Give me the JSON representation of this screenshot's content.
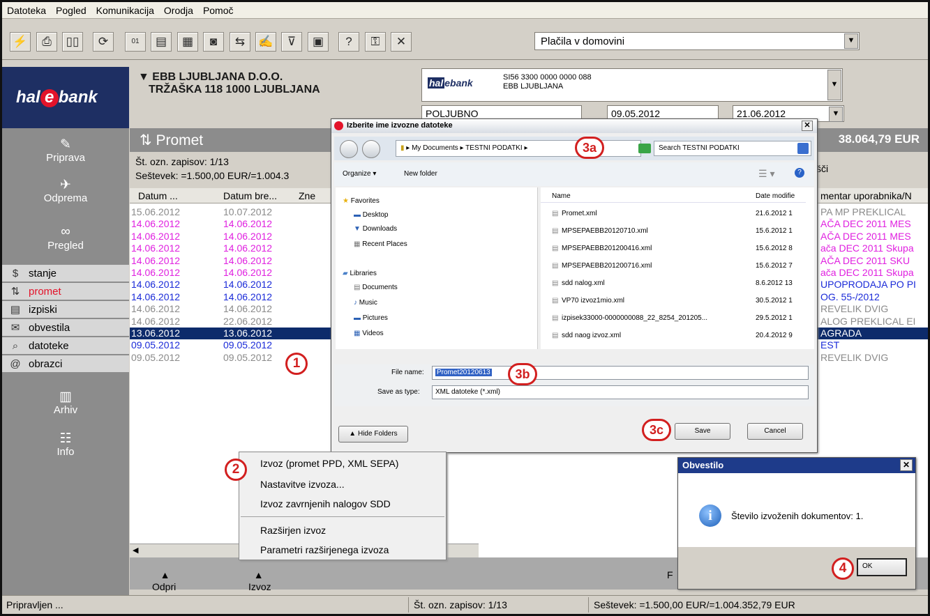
{
  "menu": [
    "Datoteka",
    "Pogled",
    "Komunikacija",
    "Orodja",
    "Pomoč"
  ],
  "toolbar": {
    "icons": [
      "plug-icon",
      "print-icon",
      "book-icon",
      "refresh-icon",
      "binary-icon",
      "document-icon",
      "card-icon",
      "disk-icon",
      "transfer-icon",
      "sign-icon",
      "filter-icon",
      "calculator-icon",
      "help-icon",
      "key-icon",
      "tools-icon"
    ],
    "select_value": "Plačila v domovini"
  },
  "sidebar": {
    "logo": "hal",
    "logo_e": "e",
    "logo_rest": "bank",
    "big_items": [
      {
        "label": "Priprava",
        "icon": "✎"
      },
      {
        "label": "Odprema",
        "icon": "✈"
      },
      {
        "label": "Pregled",
        "icon": "∞"
      }
    ],
    "small_items": [
      {
        "label": "stanje",
        "icon": "$"
      },
      {
        "label": "promet",
        "icon": "⇅"
      },
      {
        "label": "izpiski",
        "icon": "▤"
      },
      {
        "label": "obvestila",
        "icon": "✉"
      },
      {
        "label": "datoteke",
        "icon": "⌕"
      },
      {
        "label": "obrazci",
        "icon": "@"
      }
    ],
    "bottom_items": [
      {
        "label": "Arhiv",
        "icon": "▥"
      },
      {
        "label": "Info",
        "icon": "☷"
      }
    ]
  },
  "header": {
    "company_line1": "EBB LJUBLJANA D.O.O.",
    "company_line2": "TRŽAŠKA 118 1000 LJUBLJANA",
    "account_number": "SI56 3300 0000 0000 088",
    "account_name": "EBB LJUBLJANA",
    "period": "POLJUBNO",
    "date_from": "09.05.2012",
    "date_to": "21.06.2012"
  },
  "promet": {
    "title": "Promet",
    "total": "38.064,79 EUR",
    "record_count": "Št. ozn. zapisov: 1/13",
    "sum": "Seštevek: =1.500,00 EUR/=1.004.3",
    "right_label": "šči"
  },
  "grid": {
    "headers": [
      "Datum ...",
      "Datum bre...",
      "Zne",
      "mentar uporabnika/N"
    ],
    "colors": {
      "gray": "#8a8a8a",
      "magenta": "#e020e0",
      "blue": "#1a2ad8",
      "selected_bg": "#0d2b6b"
    },
    "rows": [
      {
        "d1": "15.06.2012",
        "d2": "10.07.2012",
        "c": "PA MP PREKLICAL",
        "color": "gray"
      },
      {
        "d1": "14.06.2012",
        "d2": "14.06.2012",
        "c": "AČA DEC 2011 MES",
        "color": "magenta"
      },
      {
        "d1": "14.06.2012",
        "d2": "14.06.2012",
        "c": "AČA DEC 2011 MES",
        "color": "magenta"
      },
      {
        "d1": "14.06.2012",
        "d2": "14.06.2012",
        "c": "ača DEC 2011 Skupa",
        "color": "magenta"
      },
      {
        "d1": "14.06.2012",
        "d2": "14.06.2012",
        "c": "AČA DEC 2011 SKU",
        "color": "magenta"
      },
      {
        "d1": "14.06.2012",
        "d2": "14.06.2012",
        "c": "ača DEC 2011 Skupa",
        "color": "magenta"
      },
      {
        "d1": "14.06.2012",
        "d2": "14.06.2012",
        "c": "UPOPRODAJA PO PI",
        "color": "blue"
      },
      {
        "d1": "14.06.2012",
        "d2": "14.06.2012",
        "c": "OG. 55-/2012",
        "color": "blue"
      },
      {
        "d1": "14.06.2012",
        "d2": "14.06.2012",
        "c": "REVELIK DVIG",
        "color": "gray"
      },
      {
        "d1": "14.06.2012",
        "d2": "22.06.2012",
        "c": "ALOG PREKLICAL EI",
        "color": "gray"
      },
      {
        "d1": "13.06.2012",
        "d2": "13.06.2012",
        "c": "AGRADA",
        "color": "selected"
      },
      {
        "d1": "09.05.2012",
        "d2": "09.05.2012",
        "c": "EST",
        "color": "blue"
      },
      {
        "d1": "09.05.2012",
        "d2": "09.05.2012",
        "c": "REVELIK DVIG",
        "color": "gray"
      }
    ]
  },
  "bottom": {
    "odpri": "Odpri",
    "izvoz": "Izvoz",
    "f": "F"
  },
  "status": {
    "ready": "Pripravljen ...",
    "count": "Št. ozn. zapisov: 1/13",
    "sum": "Seštevek: =1.500,00 EUR/=1.004.352,79 EUR"
  },
  "dialog": {
    "title": "Izberite ime izvozne datoteke",
    "path": "▸ My Documents ▸ TESTNI PODATKI ▸",
    "search_placeholder": "Search TESTNI PODATKI",
    "organize": "Organize ▾",
    "new_folder": "New folder",
    "tree": [
      "Favorites",
      "Desktop",
      "Downloads",
      "Recent Places",
      "Libraries",
      "Documents",
      "Music",
      "Pictures",
      "Videos"
    ],
    "col_name": "Name",
    "col_date": "Date modifie",
    "files": [
      {
        "name": "Promet.xml",
        "date": "21.6.2012 1"
      },
      {
        "name": "MPSEPAEBB20120710.xml",
        "date": "15.6.2012 1"
      },
      {
        "name": "MPSEPAEBB201200416.xml",
        "date": "15.6.2012 8"
      },
      {
        "name": "MPSEPAEBB201200716.xml",
        "date": "15.6.2012 7"
      },
      {
        "name": "sdd nalog.xml",
        "date": "8.6.2012 13"
      },
      {
        "name": "VP70 izvoz1mio.xml",
        "date": "30.5.2012 1"
      },
      {
        "name": "izpisek33000-0000000088_22_8254_201205...",
        "date": "29.5.2012 1"
      },
      {
        "name": "sdd naog izvoz.xml",
        "date": "20.4.2012 9"
      }
    ],
    "file_name_label": "File name:",
    "file_name_value": "Promet20120613",
    "save_type_label": "Save as type:",
    "save_type_value": "XML datoteke (*.xml)",
    "hide_folders": "Hide Folders",
    "save": "Save",
    "cancel": "Cancel"
  },
  "context_menu": [
    "Izvoz (promet PPD, XML SEPA)",
    "Nastavitve izvoza...",
    "Izvoz zavrnjenih nalogov SDD",
    "Razširjen izvoz",
    "Parametri razširjenega izvoza"
  ],
  "message": {
    "title": "Obvestilo",
    "text": "Število izvoženih dokumentov: 1.",
    "ok": "OK",
    "info_glyph": "i"
  },
  "markers": {
    "m1": "1",
    "m2": "2",
    "m3a": "3a",
    "m3b": "3b",
    "m3c": "3c",
    "m4": "4"
  }
}
